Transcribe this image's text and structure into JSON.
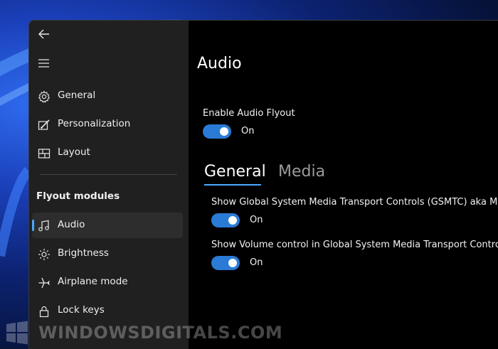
{
  "sidebar": {
    "nav": [
      {
        "label": "General",
        "icon": "gear-icon"
      },
      {
        "label": "Personalization",
        "icon": "personalization-icon"
      },
      {
        "label": "Layout",
        "icon": "layout-icon"
      }
    ],
    "section_header": "Flyout modules",
    "modules": [
      {
        "label": "Audio",
        "icon": "music-note-icon",
        "selected": true
      },
      {
        "label": "Brightness",
        "icon": "brightness-icon"
      },
      {
        "label": "Airplane mode",
        "icon": "airplane-icon"
      },
      {
        "label": "Lock keys",
        "icon": "lock-icon"
      }
    ]
  },
  "main": {
    "title": "Audio",
    "enable_label": "Enable Audio Flyout",
    "enable_state": "On",
    "tabs": [
      {
        "label": "General",
        "active": true
      },
      {
        "label": "Media",
        "active": false
      }
    ],
    "settings": [
      {
        "label": "Show Global System Media Transport Controls (GSMTC) aka Media",
        "state": "On"
      },
      {
        "label": "Show Volume control in Global System Media Transport Controls (",
        "state": "On"
      }
    ]
  },
  "watermark": "WINDOWSDIGITALS.COM",
  "colors": {
    "accent": "#2a7bd6",
    "sidebar_bg": "#202020",
    "content_bg": "#000000"
  }
}
